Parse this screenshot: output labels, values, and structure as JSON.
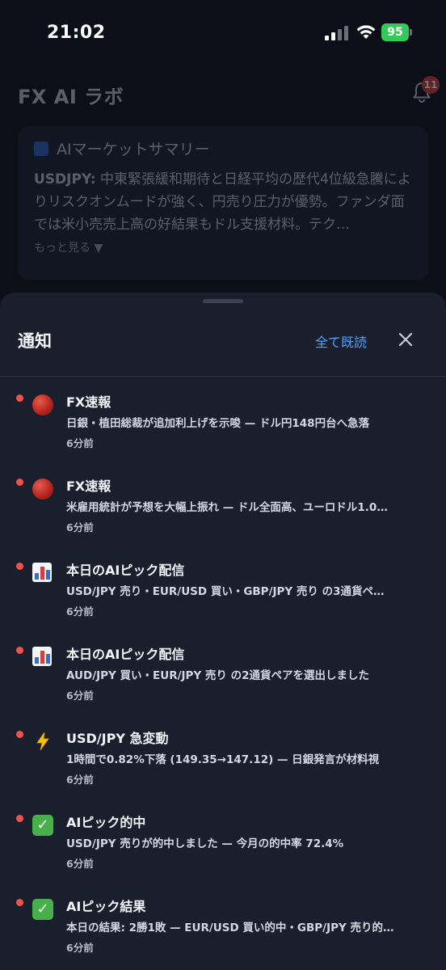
{
  "status_bar": {
    "time": "21:02",
    "battery": "95"
  },
  "app": {
    "title": "FX AI ラボ",
    "notification_badge": "11",
    "summary": {
      "title": "AIマーケットサマリー",
      "pair": "USDJPY:",
      "text": " 中東緊張緩和期待と日経平均の歴代4位級急騰によりリスクオンムードが強く、円売り圧力が優勢。ファンダ面では米小売売上高の好結果もドル支援材料。テク…",
      "more": "もっと見る ▼"
    }
  },
  "sheet": {
    "title": "通知",
    "mark_all_read": "全て既読",
    "notifications": [
      {
        "icon": "red-circle-icon",
        "title": "FX速報",
        "body": "日銀・植田総裁が追加利上げを示唆 — ドル円148円台へ急落",
        "time": "6分前"
      },
      {
        "icon": "red-circle-icon",
        "title": "FX速報",
        "body": "米雇用統計が予想を大幅上振れ — ドル全面高、ユーロドル1.0…",
        "time": "6分前"
      },
      {
        "icon": "bar-chart-icon",
        "title": "本日のAIピック配信",
        "body": "USD/JPY 売り・EUR/USD 買い・GBP/JPY 売り の3通貨ペ…",
        "time": "6分前"
      },
      {
        "icon": "bar-chart-icon",
        "title": "本日のAIピック配信",
        "body": "AUD/JPY 買い・EUR/JPY 売り の2通貨ペアを選出しました",
        "time": "6分前"
      },
      {
        "icon": "lightning-icon",
        "title": "USD/JPY 急変動",
        "body": "1時間で0.82%下落 (149.35→147.12) — 日銀発言が材料視",
        "time": "6分前"
      },
      {
        "icon": "check-mark-icon",
        "title": "AIピック的中",
        "body": "USD/JPY 売りが的中しました — 今月の的中率 72.4%",
        "time": "6分前"
      },
      {
        "icon": "check-mark-icon",
        "title": "AIピック結果",
        "body": "本日の結果: 2勝1敗 — EUR/USD 買い的中・GBP/JPY 売り的…",
        "time": "6分前"
      }
    ]
  },
  "colors": {
    "accent": "#4da3ff",
    "unread": "#ef5350",
    "sheet_bg": "#1a1f2e",
    "badge": "#e03a3a"
  }
}
